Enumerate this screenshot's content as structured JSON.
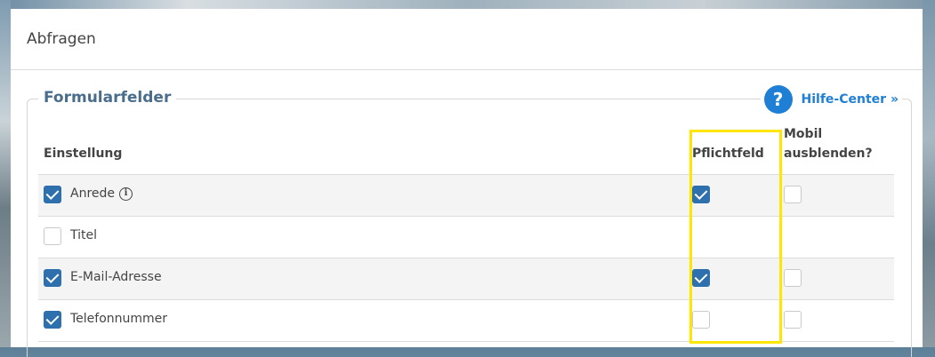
{
  "panel": {
    "title": "Abfragen"
  },
  "section": {
    "legend": "Formularfelder",
    "help": {
      "icon": "question-circle-icon",
      "label": "Hilfe-Center »"
    }
  },
  "table": {
    "headers": {
      "setting": "Einstellung",
      "required": "Pflichtfeld",
      "mobile_line1": "Mobil",
      "mobile_line2": "ausblenden?"
    },
    "rows": [
      {
        "label": "Anrede",
        "info_icon": true,
        "enabled": true,
        "required": true,
        "hide_mobile": false
      },
      {
        "label": "Titel",
        "enabled": false
      },
      {
        "label": "E-Mail-Adresse",
        "enabled": true,
        "required": true,
        "hide_mobile": false
      },
      {
        "label": "Telefonnummer",
        "enabled": true,
        "required": false,
        "hide_mobile": false
      }
    ]
  },
  "colors": {
    "accent": "#1f7fd4",
    "checkbox": "#2e6fae",
    "highlight": "#ffe600",
    "legend": "#4a6d8c"
  }
}
